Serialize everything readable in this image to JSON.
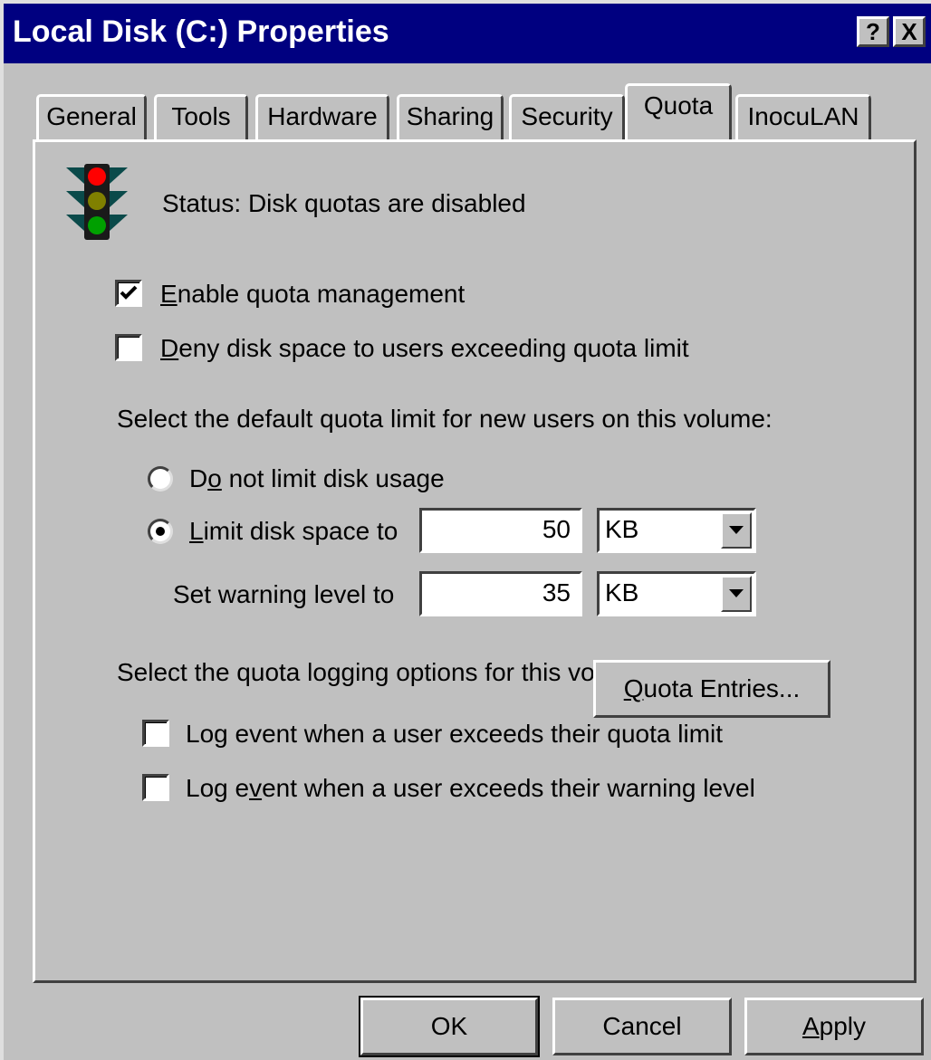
{
  "window": {
    "title": "Local Disk (C:) Properties"
  },
  "title_buttons": {
    "help": "?",
    "close": "X"
  },
  "tabs": [
    {
      "label": "General"
    },
    {
      "label": "Tools"
    },
    {
      "label": "Hardware"
    },
    {
      "label": "Sharing"
    },
    {
      "label": "Security"
    },
    {
      "label": "Quota",
      "active": true
    },
    {
      "label": "InocuLAN"
    }
  ],
  "status": {
    "icon": "traffic-light-icon",
    "text": "Status:  Disk quotas are disabled"
  },
  "options": {
    "enable_quota": {
      "pre": "",
      "key": "E",
      "post": "nable quota management",
      "checked": true
    },
    "deny_space": {
      "pre": "",
      "key": "D",
      "post": "eny disk space to users exceeding quota limit",
      "checked": false
    }
  },
  "default_limit": {
    "heading": "Select the default quota limit for new users on this volume:",
    "no_limit": {
      "pre": "D",
      "key": "o",
      "post": " not limit disk usage",
      "selected": false
    },
    "limit": {
      "pre": "",
      "key": "L",
      "post": "imit disk space to",
      "selected": true,
      "value": "50",
      "unit": "KB"
    },
    "warning": {
      "label": "Set warning level to",
      "value": "35",
      "unit": "KB"
    }
  },
  "logging": {
    "heading": "Select the quota logging options for this volume:",
    "exceed_limit": {
      "pre": "Log event when a user exceeds their quota limit",
      "key": "",
      "post": "",
      "checked": false
    },
    "exceed_warning": {
      "pre": "Log e",
      "key": "v",
      "post": "ent when a user exceeds their warning level",
      "checked": false
    }
  },
  "quota_entries_button": {
    "pre": "",
    "key": "Q",
    "post": "uota Entries..."
  },
  "footer": {
    "ok": {
      "pre": "OK",
      "key": "",
      "post": ""
    },
    "cancel": {
      "pre": "Cancel",
      "key": "",
      "post": ""
    },
    "apply": {
      "pre": "",
      "key": "A",
      "post": "pply"
    }
  }
}
